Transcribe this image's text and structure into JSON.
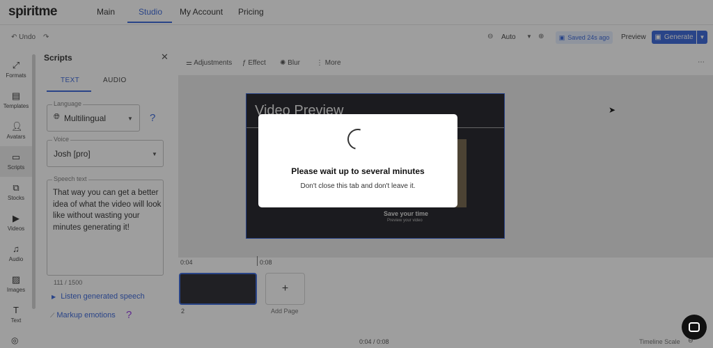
{
  "app": {
    "logo": "spiritme"
  },
  "nav": {
    "items": [
      "Main",
      "Studio",
      "My Account",
      "Pricing"
    ],
    "active": "Studio"
  },
  "toolbar": {
    "undo": "Undo",
    "zoom": "Auto",
    "saved": "Saved 24s ago",
    "preview": "Preview",
    "generate": "Generate"
  },
  "rail": {
    "items": [
      {
        "label": "Formats",
        "icon": "formats-icon"
      },
      {
        "label": "Templates",
        "icon": "templates-icon"
      },
      {
        "label": "Avatars",
        "icon": "avatar-icon"
      },
      {
        "label": "Scripts",
        "icon": "scripts-icon"
      },
      {
        "label": "Stocks",
        "icon": "stocks-icon"
      },
      {
        "label": "Videos",
        "icon": "video-icon"
      },
      {
        "label": "Audio",
        "icon": "music-icon"
      },
      {
        "label": "Images",
        "icon": "image-icon"
      },
      {
        "label": "Text",
        "icon": "text-icon"
      }
    ],
    "active": "Scripts"
  },
  "scripts": {
    "title": "Scripts",
    "tabs": [
      "TEXT",
      "AUDIO"
    ],
    "language_label": "Language",
    "language_value": "Multilingual",
    "voice_label": "Voice",
    "voice_value": "Josh [pro]",
    "speech_label": "Speech text",
    "speech_text": "That way you can get a better idea of what the video will look like without wasting your minutes generating it!",
    "counter": "111 / 1500",
    "listen": "Listen generated speech",
    "markup": "Markup emotions",
    "help": "?"
  },
  "editor": {
    "tools": [
      "Adjustments",
      "Effect",
      "Blur",
      "More"
    ],
    "video_title": "Video Preview",
    "video_sub1": "Save your time",
    "video_sub2": "Preview your video"
  },
  "timeline": {
    "marks": [
      "0:04",
      "0:08"
    ],
    "clip_number": "2",
    "add_page": "Add Page",
    "add_symbol": "+",
    "time": "0:04 / 0:08",
    "scale_label": "Timeline Scale"
  },
  "modal": {
    "title": "Please wait up to several minutes",
    "subtitle": "Don't close this tab and don't leave it."
  },
  "colors": {
    "accent": "#2b5bd7",
    "overlay": "#282828"
  }
}
